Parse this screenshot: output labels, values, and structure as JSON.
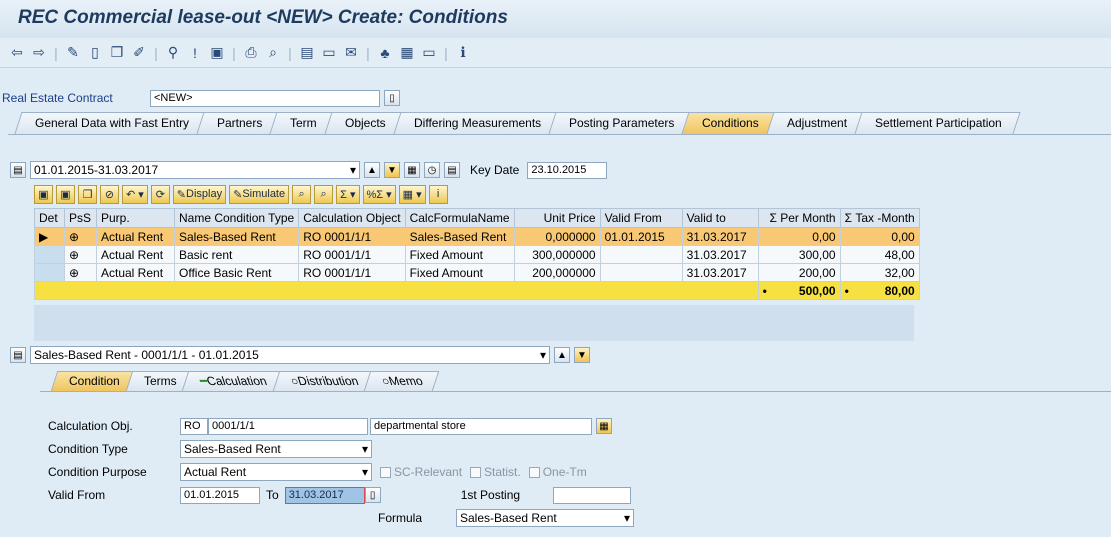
{
  "title": "REC Commercial lease-out <NEW> Create: Conditions",
  "toolbar_icons": [
    "back-icon",
    "forward-icon",
    "sep",
    "pen-icon",
    "new-doc-icon",
    "copy-icon",
    "change-icon",
    "sep",
    "link-icon",
    "info-flag-icon",
    "save-icon",
    "sep",
    "print-icon",
    "find-icon",
    "sep",
    "layout-icon",
    "doc-icon",
    "mail-icon",
    "sep",
    "hierarchy-icon",
    "grid-icon",
    "screen-icon",
    "sep",
    "info-icon"
  ],
  "contract": {
    "label": "Real Estate Contract",
    "value": "<NEW>"
  },
  "tabs": [
    "General Data with Fast Entry",
    "Partners",
    "Term",
    "Objects",
    "Differing Measurements",
    "Posting Parameters",
    "Conditions",
    "Adjustment",
    "Settlement Participation"
  ],
  "period": {
    "value": "01.01.2015-31.03.2017",
    "key_date_label": "Key Date",
    "key_date": "23.10.2015"
  },
  "grid_toolbar": {
    "display": "Display",
    "simulate": "Simulate"
  },
  "grid": {
    "headers": [
      "Det",
      "PsS",
      "Purp.",
      "Name Condition Type",
      "Calculation Object",
      "CalcFormulaName",
      "Unit Price",
      "Valid From",
      "Valid to",
      "Σ Per Month",
      "Σ Tax -Month"
    ],
    "rows": [
      {
        "purp": "Actual Rent",
        "name": "Sales-Based Rent",
        "obj": "RO 0001/1/1",
        "formula": "Sales-Based Rent",
        "price": "0,000000",
        "from": "01.01.2015",
        "to": "31.03.2017",
        "month": "0,00",
        "tax": "0,00"
      },
      {
        "purp": "Actual Rent",
        "name": "Basic rent",
        "obj": "RO 0001/1/1",
        "formula": "Fixed Amount",
        "price": "300,000000",
        "from": "",
        "to": "31.03.2017",
        "month": "300,00",
        "tax": "48,00"
      },
      {
        "purp": "Actual Rent",
        "name": "Office Basic Rent",
        "obj": "RO 0001/1/1",
        "formula": "Fixed Amount",
        "price": "200,000000",
        "from": "",
        "to": "31.03.2017",
        "month": "200,00",
        "tax": "32,00"
      }
    ],
    "total_month": "500,00",
    "total_tax": "80,00",
    "total_marker": "•"
  },
  "condition_select": "Sales-Based Rent - 0001/1/1 - 01.01.2015",
  "subtabs": [
    "Condition",
    "Terms",
    "Calculation",
    "Distribution",
    "Memo"
  ],
  "form": {
    "calc_obj_label": "Calculation Obj.",
    "calc_obj_type": "RO",
    "calc_obj_id": "0001/1/1",
    "calc_obj_desc": "departmental store",
    "cond_type_label": "Condition Type",
    "cond_type": "Sales-Based Rent",
    "cond_purpose_label": "Condition Purpose",
    "cond_purpose": "Actual Rent",
    "sc_relevant": "SC-Relevant",
    "statist": "Statist.",
    "one_tm": "One-Tm",
    "valid_from_label": "Valid From",
    "valid_from": "01.01.2015",
    "to_label": "To",
    "valid_to": "31.03.2017",
    "first_posting_label": "1st Posting",
    "first_posting": "",
    "formula_label": "Formula",
    "formula": "Sales-Based Rent"
  }
}
